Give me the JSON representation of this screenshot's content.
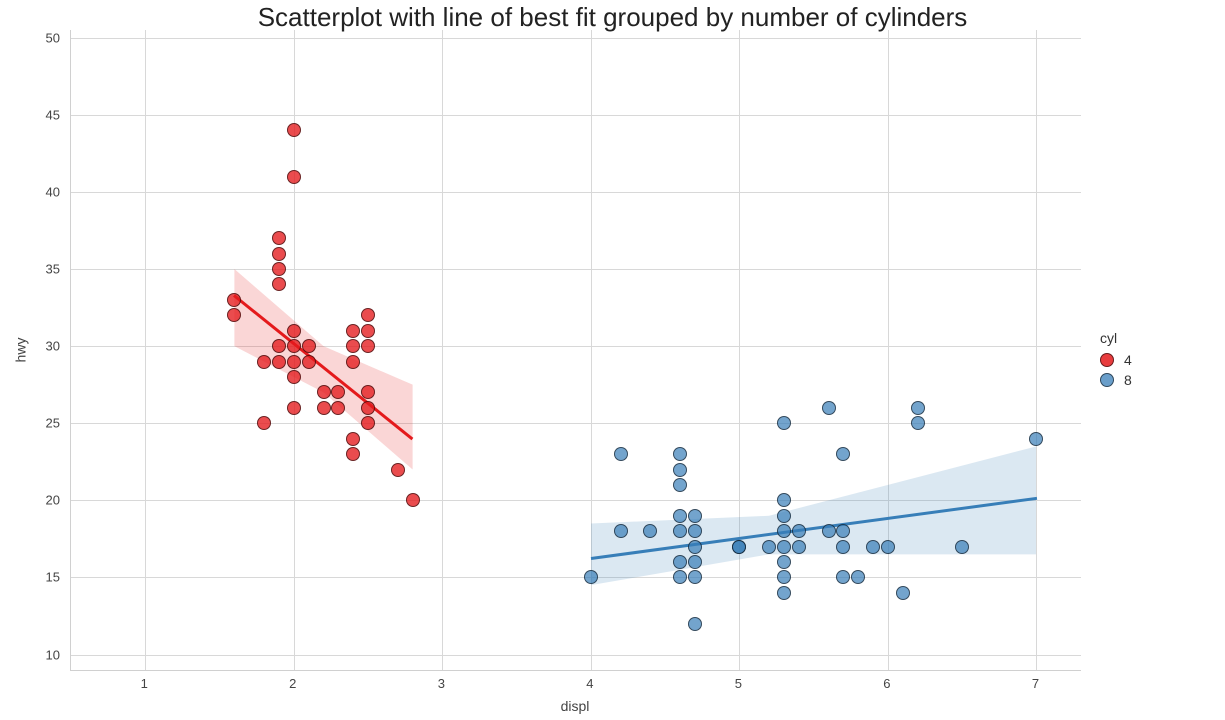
{
  "chart_data": {
    "type": "scatter",
    "title": "Scatterplot with line of best fit grouped by number of cylinders",
    "xlabel": "displ",
    "ylabel": "hwy",
    "xlim": [
      0.5,
      7.3
    ],
    "ylim": [
      9,
      50.5
    ],
    "xticks": [
      1,
      2,
      3,
      4,
      5,
      6,
      7
    ],
    "yticks": [
      10,
      15,
      20,
      25,
      30,
      35,
      40,
      45,
      50
    ],
    "legend_title": "cyl",
    "series": [
      {
        "name": "4",
        "color": "#e41a1c",
        "points": [
          {
            "x": 1.6,
            "y": 33
          },
          {
            "x": 1.6,
            "y": 32
          },
          {
            "x": 1.8,
            "y": 29
          },
          {
            "x": 1.8,
            "y": 25
          },
          {
            "x": 1.9,
            "y": 37
          },
          {
            "x": 1.9,
            "y": 36
          },
          {
            "x": 1.9,
            "y": 35
          },
          {
            "x": 1.9,
            "y": 34
          },
          {
            "x": 1.9,
            "y": 29
          },
          {
            "x": 1.9,
            "y": 30
          },
          {
            "x": 2.0,
            "y": 44
          },
          {
            "x": 2.0,
            "y": 41
          },
          {
            "x": 2.0,
            "y": 31
          },
          {
            "x": 2.0,
            "y": 30
          },
          {
            "x": 2.0,
            "y": 29
          },
          {
            "x": 2.0,
            "y": 28
          },
          {
            "x": 2.0,
            "y": 26
          },
          {
            "x": 2.1,
            "y": 30
          },
          {
            "x": 2.1,
            "y": 29
          },
          {
            "x": 2.2,
            "y": 27
          },
          {
            "x": 2.2,
            "y": 26
          },
          {
            "x": 2.3,
            "y": 27
          },
          {
            "x": 2.3,
            "y": 26
          },
          {
            "x": 2.4,
            "y": 31
          },
          {
            "x": 2.4,
            "y": 30
          },
          {
            "x": 2.4,
            "y": 29
          },
          {
            "x": 2.4,
            "y": 24
          },
          {
            "x": 2.4,
            "y": 23
          },
          {
            "x": 2.5,
            "y": 32
          },
          {
            "x": 2.5,
            "y": 31
          },
          {
            "x": 2.5,
            "y": 30
          },
          {
            "x": 2.5,
            "y": 27
          },
          {
            "x": 2.5,
            "y": 26
          },
          {
            "x": 2.5,
            "y": 25
          },
          {
            "x": 2.7,
            "y": 22
          },
          {
            "x": 2.8,
            "y": 20
          }
        ],
        "fit": {
          "x1": 1.6,
          "y1": 33.3,
          "x2": 2.8,
          "y2": 24.0
        },
        "ci": [
          {
            "x": 1.6,
            "lo": 30.0,
            "hi": 35.0
          },
          {
            "x": 2.2,
            "lo": 27.0,
            "hi": 30.0
          },
          {
            "x": 2.8,
            "lo": 22.0,
            "hi": 27.5
          }
        ]
      },
      {
        "name": "8",
        "color": "#377eb8",
        "points": [
          {
            "x": 4.0,
            "y": 15
          },
          {
            "x": 4.2,
            "y": 23
          },
          {
            "x": 4.2,
            "y": 18
          },
          {
            "x": 4.4,
            "y": 18
          },
          {
            "x": 4.6,
            "y": 23
          },
          {
            "x": 4.6,
            "y": 22
          },
          {
            "x": 4.6,
            "y": 21
          },
          {
            "x": 4.6,
            "y": 19
          },
          {
            "x": 4.6,
            "y": 18
          },
          {
            "x": 4.6,
            "y": 16
          },
          {
            "x": 4.6,
            "y": 15
          },
          {
            "x": 4.7,
            "y": 19
          },
          {
            "x": 4.7,
            "y": 18
          },
          {
            "x": 4.7,
            "y": 17
          },
          {
            "x": 4.7,
            "y": 16
          },
          {
            "x": 4.7,
            "y": 15
          },
          {
            "x": 4.7,
            "y": 12
          },
          {
            "x": 5.0,
            "y": 17
          },
          {
            "x": 5.0,
            "y": 17
          },
          {
            "x": 5.2,
            "y": 17
          },
          {
            "x": 5.3,
            "y": 25
          },
          {
            "x": 5.3,
            "y": 20
          },
          {
            "x": 5.3,
            "y": 19
          },
          {
            "x": 5.3,
            "y": 18
          },
          {
            "x": 5.3,
            "y": 17
          },
          {
            "x": 5.3,
            "y": 16
          },
          {
            "x": 5.3,
            "y": 15
          },
          {
            "x": 5.3,
            "y": 14
          },
          {
            "x": 5.4,
            "y": 18
          },
          {
            "x": 5.4,
            "y": 17
          },
          {
            "x": 5.6,
            "y": 26
          },
          {
            "x": 5.6,
            "y": 18
          },
          {
            "x": 5.7,
            "y": 23
          },
          {
            "x": 5.7,
            "y": 18
          },
          {
            "x": 5.7,
            "y": 17
          },
          {
            "x": 5.7,
            "y": 15
          },
          {
            "x": 5.8,
            "y": 15
          },
          {
            "x": 5.9,
            "y": 17
          },
          {
            "x": 6.0,
            "y": 17
          },
          {
            "x": 6.1,
            "y": 14
          },
          {
            "x": 6.2,
            "y": 26
          },
          {
            "x": 6.2,
            "y": 25
          },
          {
            "x": 6.5,
            "y": 17
          },
          {
            "x": 7.0,
            "y": 24
          }
        ],
        "fit": {
          "x1": 4.0,
          "y1": 16.2,
          "x2": 7.0,
          "y2": 20.1
        },
        "ci": [
          {
            "x": 4.0,
            "lo": 14.5,
            "hi": 18.5
          },
          {
            "x": 5.2,
            "lo": 16.5,
            "hi": 19.0
          },
          {
            "x": 7.0,
            "lo": 16.5,
            "hi": 23.5
          }
        ]
      }
    ]
  }
}
